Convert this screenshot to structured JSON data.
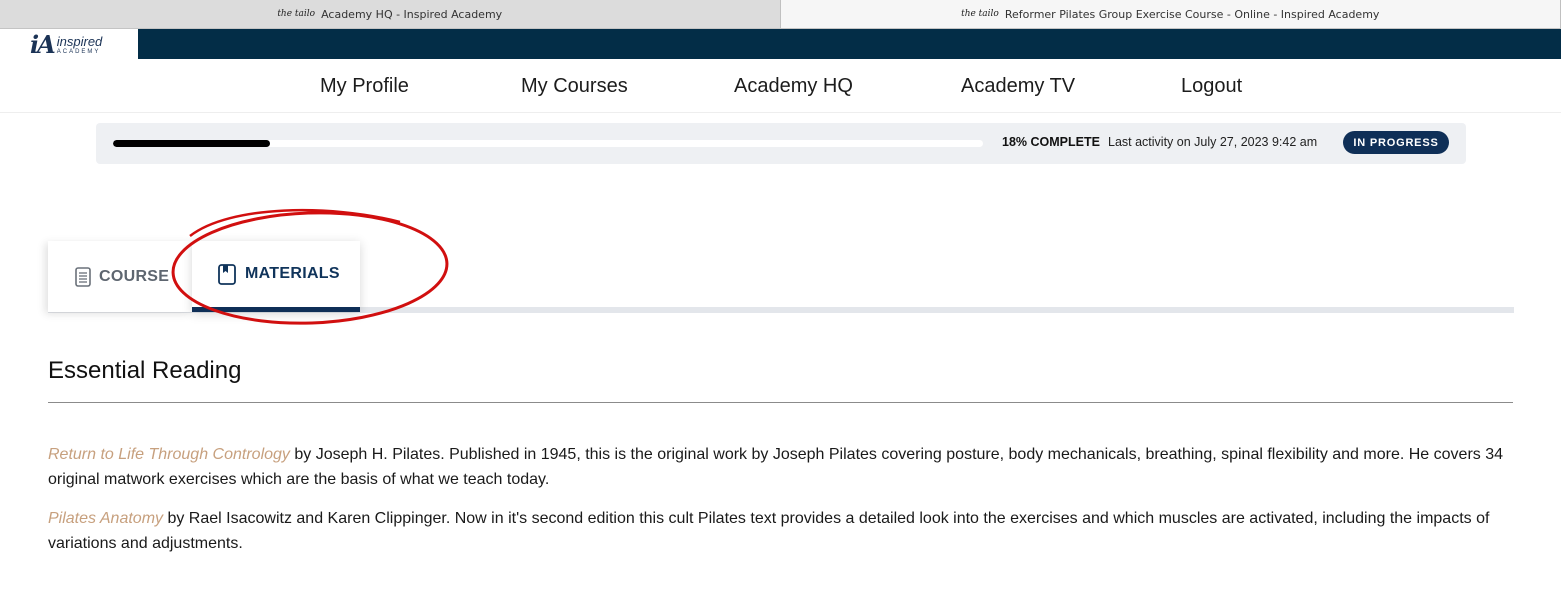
{
  "browser_tabs": [
    {
      "favicon_text": "the tailo",
      "title": "Academy HQ - Inspired Academy",
      "active": false
    },
    {
      "favicon_text": "the tailo",
      "title": "Reformer Pilates Group Exercise Course - Online - Inspired Academy",
      "active": true
    }
  ],
  "logo": {
    "mark": "iA",
    "word1": "inspired",
    "word2": "ACADEMY"
  },
  "nav": {
    "items": [
      "My Profile",
      "My Courses",
      "Academy HQ",
      "Academy TV",
      "Logout"
    ]
  },
  "progress": {
    "percent": 18,
    "percent_label": "18% COMPLETE",
    "last_activity": "Last activity on July 27, 2023 9:42 am",
    "status": "IN PROGRESS"
  },
  "content_tabs": [
    {
      "label": "COURSE",
      "icon": "document-icon",
      "active": false
    },
    {
      "label": "MATERIALS",
      "icon": "bookmark-book-icon",
      "active": true
    }
  ],
  "colors": {
    "header_band": "#032d47",
    "accent": "#0f2f57",
    "link": "#c7a07e",
    "annotation": "#d10f0f"
  },
  "materials": {
    "heading": "Essential Reading",
    "paragraphs": [
      {
        "link": "Return to Life Through Contrology",
        "text": " by Joseph H. Pilates. Published in 1945, this is the original work by Joseph Pilates covering posture, body mechanicals, breathing, spinal flexibility and more. He covers 34 original matwork exercises which are the basis of what we teach today."
      },
      {
        "link": "Pilates Anatomy",
        "text": " by Rael Isacowitz and Karen Clippinger. Now in it's second edition this cult Pilates text provides a detailed look into the exercises and which muscles are activated, including the impacts of variations and adjustments."
      }
    ]
  }
}
